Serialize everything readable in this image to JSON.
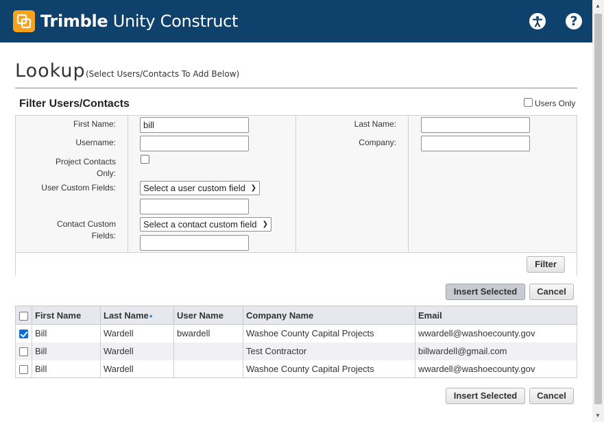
{
  "header": {
    "brand_bold": "Trimble",
    "brand_rest": " Unity Construct",
    "accent_color": "#f6a21d",
    "background_color": "#0e416c",
    "help_glyph": "?",
    "icons": [
      "trimble-logo-icon",
      "accessibility-icon",
      "help-icon"
    ]
  },
  "page": {
    "title": "Lookup",
    "subtitle": "(Select Users/Contacts To Add Below)"
  },
  "filter": {
    "heading": "Filter Users/Contacts",
    "users_only_label": "Users Only",
    "users_only_checked": false,
    "first_name_label": "First Name:",
    "first_name_value": "bill",
    "last_name_label": "Last Name:",
    "last_name_value": "",
    "username_label": "Username:",
    "username_value": "",
    "company_label": "Company:",
    "company_value": "",
    "project_contacts_label_1": "Project Contacts",
    "project_contacts_label_2": "Only:",
    "project_contacts_checked": false,
    "user_custom_label": "User Custom Fields:",
    "user_custom_select": "Select a user custom field",
    "user_custom_value": "",
    "contact_custom_label_1": "Contact Custom",
    "contact_custom_label_2": "Fields:",
    "contact_custom_select": "Select a contact custom field",
    "contact_custom_value": "",
    "filter_button": "Filter"
  },
  "actions": {
    "insert_selected": "Insert Selected",
    "cancel": "Cancel"
  },
  "table": {
    "columns": [
      "First Name",
      "Last Name",
      "User Name",
      "Company Name",
      "Email"
    ],
    "sorted_column": "Last Name",
    "rows": [
      {
        "checked": true,
        "first": "Bill",
        "last": "Wardell",
        "user": "bwardell",
        "company": "Washoe County Capital Projects",
        "email": "wwardell@washoecounty.gov"
      },
      {
        "checked": false,
        "first": "Bill",
        "last": "Wardell",
        "user": "",
        "company": "Test Contractor",
        "email": "billwardell@gmail.com"
      },
      {
        "checked": false,
        "first": "Bill",
        "last": "Wardell",
        "user": "",
        "company": "Washoe County Capital Projects",
        "email": "wwardell@washoecounty.gov"
      }
    ]
  }
}
